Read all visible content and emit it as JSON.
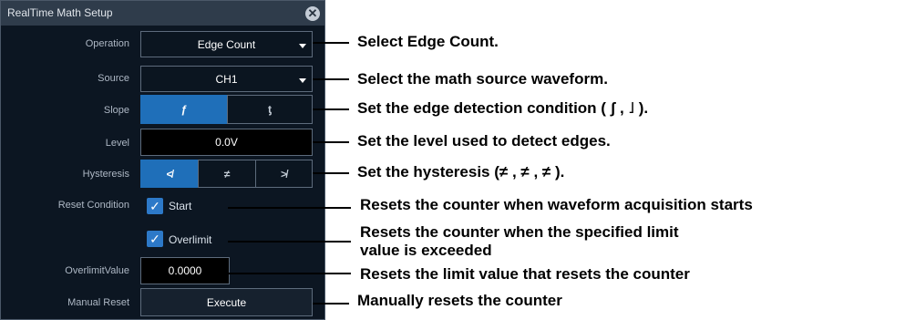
{
  "dialog": {
    "title": "RealTime Math Setup",
    "close_icon": "close-icon",
    "operation": {
      "label": "Operation",
      "value": "Edge Count"
    },
    "source": {
      "label": "Source",
      "value": "CH1"
    },
    "slope": {
      "label": "Slope",
      "options": [
        "ƒ",
        "ƫ"
      ],
      "selected": 0
    },
    "level": {
      "label": "Level",
      "value": "0.0V"
    },
    "hysteresis": {
      "label": "Hysteresis",
      "options": [
        "≮",
        "≠",
        "≯"
      ],
      "selected": 0
    },
    "reset_condition": {
      "label": "Reset Condition",
      "start": "Start",
      "overlimit": "Overlimit",
      "start_checked": true,
      "overlimit_checked": true
    },
    "overlimit_value": {
      "label": "OverlimitValue",
      "value": "0.0000"
    },
    "manual_reset": {
      "label": "Manual Reset",
      "button": "Execute"
    }
  },
  "annotations": {
    "operation": "Select Edge Count.",
    "source": "Select the math source waveform.",
    "slope": "Set the edge detection condition ( ʃ , ˩ ).",
    "level": "Set the level used to detect edges.",
    "hysteresis": "Set the hysteresis (≠ , ≠ , ≠ ).",
    "start": "Resets the counter when waveform acquisition starts",
    "overlimit_line1": "Resets the counter when the specified limit",
    "overlimit_line2": "value is exceeded",
    "overlimit_value": "Resets the limit value that resets the counter",
    "manual_reset": "Manually resets the counter"
  }
}
